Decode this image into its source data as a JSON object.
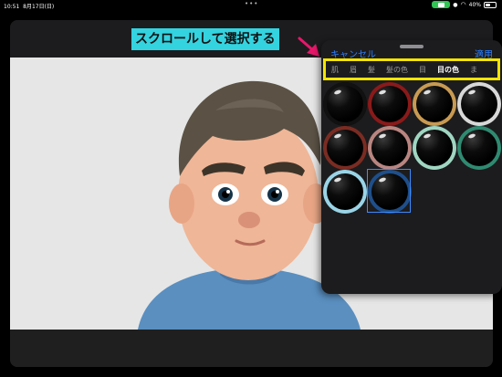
{
  "status": {
    "time": "10:51",
    "date": "8月17日(日)",
    "battery": "40%",
    "battery_level": 0.4
  },
  "annotation": {
    "callout_text": "スクロールして選択する",
    "highlight_color": "#f5e400",
    "callout_color": "#34d3e0",
    "arrow_color": "#e8176a"
  },
  "panel": {
    "cancel_label": "キャンセル",
    "apply_label": "適用",
    "tabs": [
      "肌",
      "眉",
      "髪",
      "髪の色",
      "目",
      "目の色",
      "ま"
    ],
    "active_tab": "目の色",
    "swatches": [
      {
        "name": "black",
        "ring": "#111111"
      },
      {
        "name": "red",
        "ring": "#8a1a1a"
      },
      {
        "name": "gold",
        "ring": "#c89a52"
      },
      {
        "name": "silver",
        "ring": "#d8d8d8"
      },
      {
        "name": "brown",
        "ring": "#7a2c22"
      },
      {
        "name": "rose",
        "ring": "#b98580"
      },
      {
        "name": "mint",
        "ring": "#9fd6c2"
      },
      {
        "name": "green",
        "ring": "#2f8a70"
      },
      {
        "name": "light-blue",
        "ring": "#9ad4e6"
      },
      {
        "name": "blue",
        "ring": "#1f4f8a",
        "selected": true
      }
    ]
  }
}
